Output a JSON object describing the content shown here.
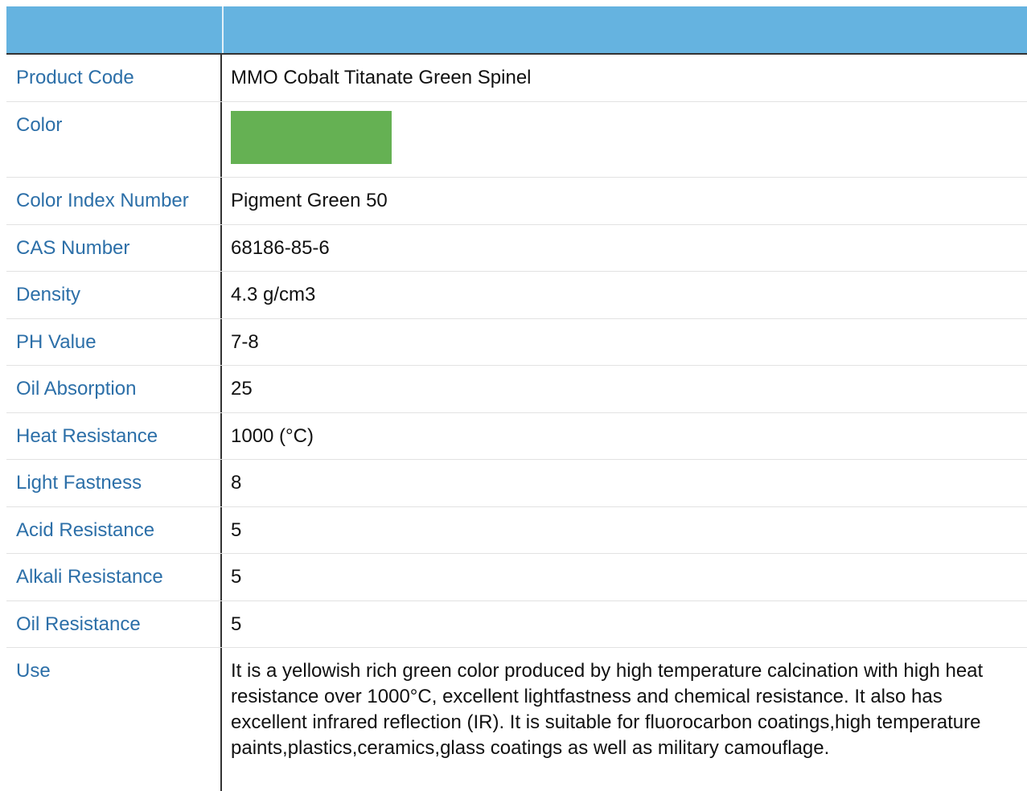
{
  "table": {
    "rows": [
      {
        "label": "Product Code",
        "value": "MMO Cobalt Titanate Green Spinel"
      },
      {
        "label": "Color",
        "swatch_color": "#65b153"
      },
      {
        "label": "Color Index Number",
        "value": "Pigment Green 50"
      },
      {
        "label": "CAS Number",
        "value": "68186-85-6"
      },
      {
        "label": "Density",
        "value": "4.3 g/cm3"
      },
      {
        "label": "PH Value",
        "value": "7-8"
      },
      {
        "label": "Oil Absorption",
        "value": "25"
      },
      {
        "label": "Heat Resistance",
        "value": "1000 (°C)"
      },
      {
        "label": "Light Fastness",
        "value": "8"
      },
      {
        "label": "Acid Resistance",
        "value": "5"
      },
      {
        "label": "Alkali Resistance",
        "value": "5"
      },
      {
        "label": "Oil Resistance",
        "value": "5"
      },
      {
        "label": "Use",
        "value": "It is a yellowish rich green color produced by high temperature calcination with high heat resistance over 1000°C, excellent lightfastness and chemical resistance. It also has excellent infrared reflection (IR). It is suitable for fluorocarbon coatings,high temperature paints,plastics,ceramics,glass coatings as well as military camouflage."
      }
    ]
  },
  "colors": {
    "header_bg": "#65b3e0",
    "label_text": "#2c6fa8"
  }
}
